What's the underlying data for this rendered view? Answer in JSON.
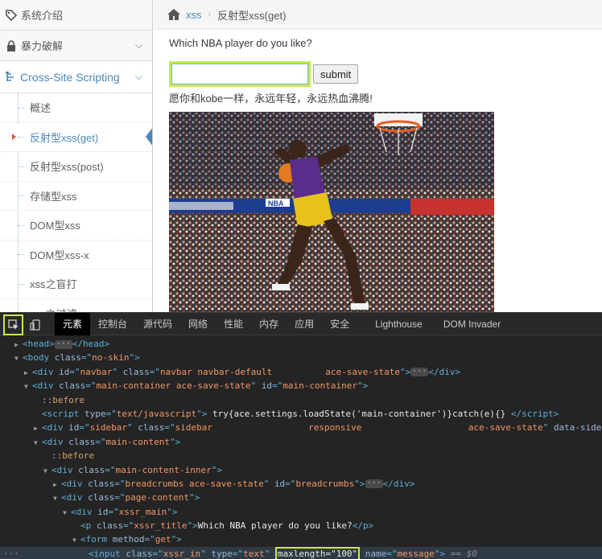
{
  "sidebar": {
    "items": [
      {
        "label": "系统介绍",
        "icon": "tag-icon"
      },
      {
        "label": "暴力破解",
        "icon": "lock-icon"
      }
    ],
    "active_section": {
      "label": "Cross-Site Scripting",
      "icon": "sitemap-icon"
    },
    "sub_items": [
      {
        "label": "概述"
      },
      {
        "label": "反射型xss(get)",
        "active": true
      },
      {
        "label": "反射型xss(post)"
      },
      {
        "label": "存储型xss"
      },
      {
        "label": "DOM型xss"
      },
      {
        "label": "DOM型xss-x"
      },
      {
        "label": "xss之盲打"
      },
      {
        "label": "xss之过滤"
      }
    ]
  },
  "breadcrumbs": {
    "link": "xss",
    "current": "反射型xss(get)"
  },
  "main": {
    "question": "Which NBA player do you like?",
    "input_value": "",
    "submit_label": "submit",
    "message": "愿你和kobe一样，永远年轻，永远热血沸腾!"
  },
  "devtools": {
    "tabs": [
      "元素",
      "控制台",
      "源代码",
      "网络",
      "性能",
      "内存",
      "应用",
      "安全",
      "Lighthouse",
      "DOM Invader"
    ],
    "active_tab": "元素",
    "lines": {
      "l1": {
        "tag": "head"
      },
      "l2": {
        "cls": "no-skin"
      },
      "l3": {
        "id": "navbar",
        "cls": "navbar navbar-default          ace-save-state"
      },
      "l4": {
        "cls": "main-container ace-save-state",
        "id": "main-container"
      },
      "l5": "::before",
      "l6": {
        "type": "text/javascript",
        "code": "try{ace.settings.loadState('main-container')}catch(e){}"
      },
      "l7": {
        "id": "sidebar",
        "cls": "sidebar                  responsive                    ace-save-state",
        "extra": "data-sideb"
      },
      "l8": {
        "cls": "main-content"
      },
      "l9": "::before",
      "l10": {
        "cls": "main-content-inner"
      },
      "l11": {
        "cls": "breadcrumbs ace-save-state",
        "id": "breadcrumbs"
      },
      "l12": {
        "cls": "page-content"
      },
      "l13": {
        "id": "xssr_main"
      },
      "l14": {
        "cls": "xssr_title",
        "text": "Which NBA player do you like?"
      },
      "l15": {
        "method": "get"
      },
      "l16": {
        "cls": "xssr_in",
        "type": "text",
        "maxlength_attr": "maxlength=\"100\"",
        "name": "message",
        "tail": "== $0"
      }
    }
  },
  "colors": {
    "highlight": "#c7e94f",
    "link": "#4c8fbd",
    "devtools_bg": "#242424"
  }
}
